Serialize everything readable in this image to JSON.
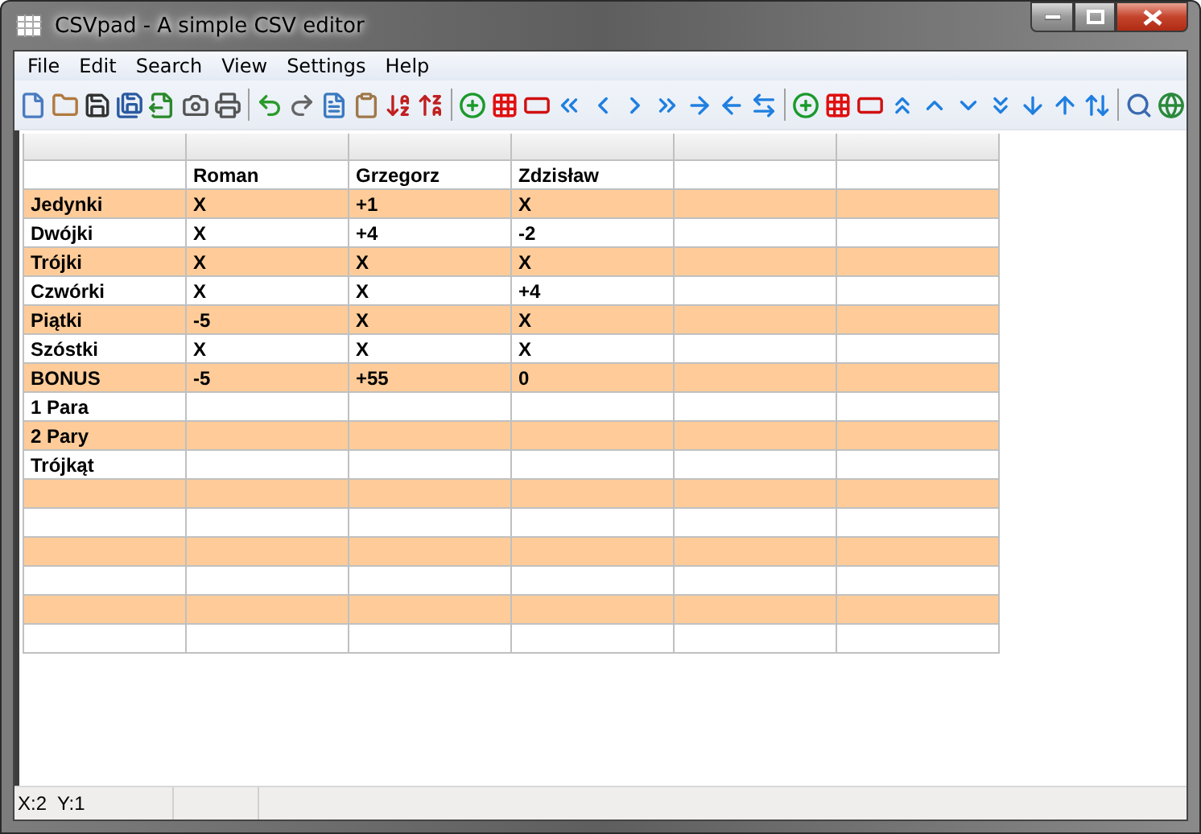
{
  "window": {
    "title": "CSVpad - A simple CSV editor"
  },
  "menu": [
    "File",
    "Edit",
    "Search",
    "View",
    "Settings",
    "Help"
  ],
  "grid": {
    "rows": [
      {
        "cells": [
          null,
          "Roman",
          "Grzegorz",
          "Zdzisław"
        ]
      },
      {
        "cells": [
          "Jedynki",
          "X",
          "+1",
          "X"
        ]
      },
      {
        "cells": [
          "Dwójki",
          "X",
          "+4",
          "-2"
        ]
      },
      {
        "cells": [
          "Trójki",
          "X",
          "X",
          "X"
        ]
      },
      {
        "cells": [
          "Czwórki",
          "X",
          "X",
          "+4"
        ]
      },
      {
        "cells": [
          "Piątki",
          "-5",
          "X",
          "X"
        ]
      },
      {
        "cells": [
          "Szóstki",
          "X",
          "X",
          "X"
        ]
      },
      {
        "cells": [
          "BONUS",
          "-5",
          "+55",
          "0"
        ]
      },
      {
        "cells": [
          "1 Para"
        ]
      },
      {
        "cells": [
          "2 Pary"
        ]
      },
      {
        "cells": [
          "Trójkąt"
        ]
      },
      {},
      {},
      {},
      {},
      {},
      {}
    ]
  },
  "status_bar": [
    "X:2  Y:1"
  ]
}
